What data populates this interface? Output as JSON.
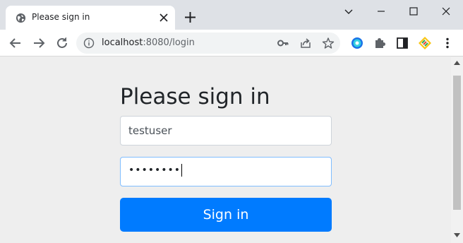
{
  "browser": {
    "tab": {
      "title": "Please sign in"
    },
    "omnibox": {
      "host": "localhost",
      "path": ":8080/login"
    }
  },
  "page": {
    "heading": "Please sign in",
    "username": {
      "value": "testuser"
    },
    "password": {
      "masked": "••••••••"
    },
    "submit_label": "Sign in"
  },
  "colors": {
    "primary_button": "#007bff",
    "page_background": "#eeeeee",
    "focus_border": "#80bdff"
  },
  "icons": {
    "tab": [
      "globe-icon",
      "close-icon",
      "plus-icon"
    ],
    "window": [
      "chevron-down-icon",
      "minimize-icon",
      "maximize-icon",
      "close-icon"
    ],
    "nav": [
      "back-arrow-icon",
      "forward-arrow-icon",
      "reload-icon"
    ],
    "omnibox": [
      "info-icon",
      "key-icon",
      "share-icon",
      "star-icon"
    ],
    "extensions": [
      "extension-circle-icon",
      "puzzle-icon",
      "sidepanel-icon",
      "extension-diamond-icon",
      "more-vert-icon"
    ]
  }
}
